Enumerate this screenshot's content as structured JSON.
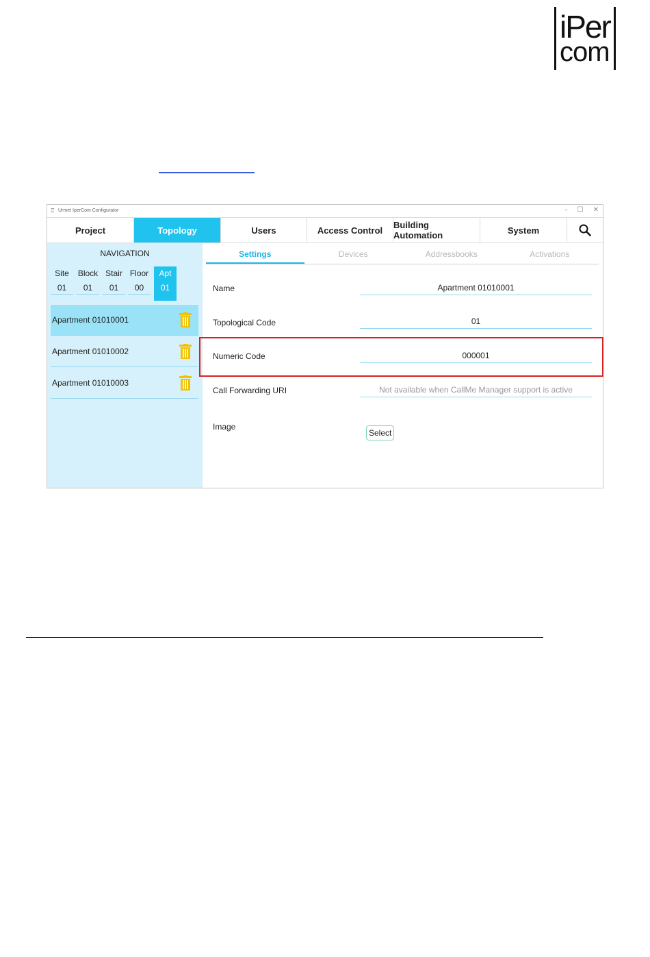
{
  "brand": {
    "line1": "iPer",
    "line2": "com"
  },
  "window": {
    "title": "Urmet IperCom Configurator",
    "controls": {
      "minimize": "–",
      "maximize": "☐",
      "close": "✕"
    }
  },
  "menu": {
    "items": [
      {
        "label": "Project"
      },
      {
        "label": "Topology"
      },
      {
        "label": "Users"
      },
      {
        "label": "Access Control"
      },
      {
        "label": "Building Automation"
      },
      {
        "label": "System"
      }
    ],
    "active": "Topology",
    "search_icon": "search-icon"
  },
  "navigation": {
    "title": "NAVIGATION",
    "topology": [
      {
        "label": "Site",
        "value": "01"
      },
      {
        "label": "Block",
        "value": "01"
      },
      {
        "label": "Stair",
        "value": "01"
      },
      {
        "label": "Floor",
        "value": "00"
      },
      {
        "label": "Apt",
        "value": "01"
      }
    ],
    "apartments": [
      {
        "name": "Apartment 01010001",
        "selected": true
      },
      {
        "name": "Apartment 01010002",
        "selected": false
      },
      {
        "name": "Apartment 01010003",
        "selected": false
      }
    ],
    "delete_icon": "trash-icon"
  },
  "tabs": [
    {
      "label": "Settings",
      "active": true
    },
    {
      "label": "Devices",
      "active": false
    },
    {
      "label": "Addressbooks",
      "active": false
    },
    {
      "label": "Activations",
      "active": false
    }
  ],
  "settings": {
    "name": {
      "label": "Name",
      "value": "Apartment 01010001"
    },
    "topological_code": {
      "label": "Topological Code",
      "value": "01"
    },
    "numeric_code": {
      "label": "Numeric Code",
      "value": "000001"
    },
    "call_forwarding": {
      "label": "Call Forwarding URI",
      "placeholder": "Not available when CallMe Manager support is active"
    },
    "image": {
      "label": "Image",
      "button": "Select"
    }
  },
  "colors": {
    "accent": "#1fc3ee",
    "nav_bg": "#d6f1fb",
    "selected_row": "#9ae2f7",
    "trash": "#f2c200",
    "highlight": "#d92121"
  }
}
